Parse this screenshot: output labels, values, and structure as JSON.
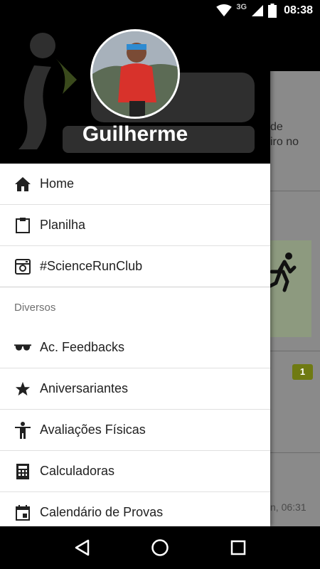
{
  "status_bar": {
    "network": "3G",
    "time": "08:38",
    "icons": [
      "wifi-icon",
      "cell-signal-icon",
      "battery-icon"
    ]
  },
  "background_app": {
    "text_line_1": "de",
    "text_line_2": "iro no",
    "badge_count": "1",
    "timestamp": "n, 06:31",
    "colors": {
      "badge": "#6f7a12",
      "card": "#8d9a7f"
    }
  },
  "drawer": {
    "user_name": "Guilherme",
    "menu_items": [
      {
        "label": "Home",
        "icon": "home-icon"
      },
      {
        "label": "Planilha",
        "icon": "clipboard-icon"
      },
      {
        "label": "#ScienceRunClub",
        "icon": "instagram-icon"
      }
    ],
    "section_title": "Diversos",
    "section_items": [
      {
        "label": "Ac. Feedbacks",
        "icon": "sunglasses-icon"
      },
      {
        "label": "Aniversariantes",
        "icon": "star-icon"
      },
      {
        "label": "Avaliações Físicas",
        "icon": "person-icon"
      },
      {
        "label": "Calculadoras",
        "icon": "calculator-icon"
      },
      {
        "label": "Calendário de Provas",
        "icon": "calendar-icon"
      }
    ]
  },
  "nav_bar": {
    "buttons": [
      "back-icon",
      "home-circle-icon",
      "recents-icon"
    ]
  }
}
